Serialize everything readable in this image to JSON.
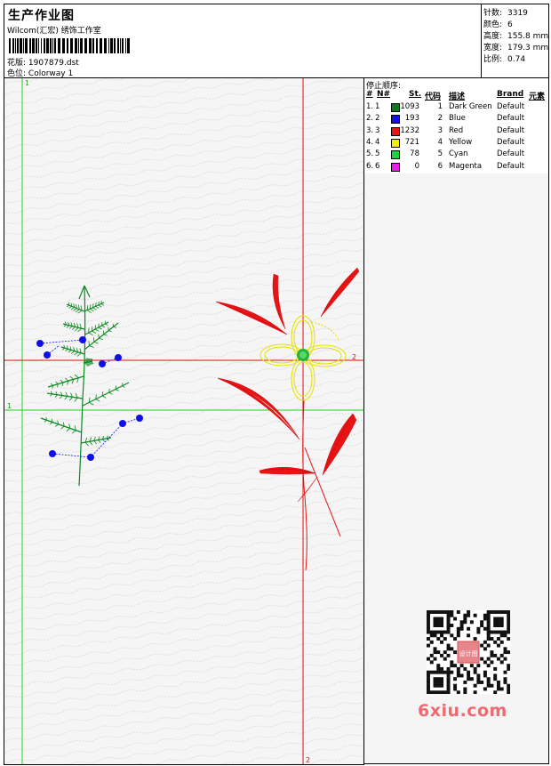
{
  "header": {
    "title": "生产作业图",
    "subtitle": "Wilcom(汇宏) 绣饰工作室",
    "design_label": "花版:",
    "design_value": "1907879.dst",
    "colorway_label": "色位:",
    "colorway_value": "Colorway 1"
  },
  "stats": [
    {
      "label": "针数:",
      "value": "3319"
    },
    {
      "label": "颜色:",
      "value": "6"
    },
    {
      "label": "高度:",
      "value": "155.8 mm"
    },
    {
      "label": "宽度:",
      "value": "179.3 mm"
    },
    {
      "label": "比例:",
      "value": "0.74"
    }
  ],
  "canvas": {
    "guide_label_top": "1",
    "guide_label_right": "2",
    "guide_label_left": "1",
    "guide_label_bottom": "2"
  },
  "color_table": {
    "title": "停止顺序:",
    "headers": {
      "num": "#",
      "n": "N#",
      "st": "St.",
      "code": "代码",
      "desc": "描述",
      "brand": "Brand",
      "elem": "元素"
    },
    "rows": [
      {
        "num": "1.",
        "n": "1",
        "color": "#0a7d1e",
        "st": "1093",
        "code": "1",
        "desc": "Dark Green",
        "brand": "Default"
      },
      {
        "num": "2.",
        "n": "2",
        "color": "#1010e6",
        "st": "193",
        "code": "2",
        "desc": "Blue",
        "brand": "Default"
      },
      {
        "num": "3.",
        "n": "3",
        "color": "#e61414",
        "st": "1232",
        "code": "3",
        "desc": "Red",
        "brand": "Default"
      },
      {
        "num": "4.",
        "n": "4",
        "color": "#f2ee10",
        "st": "721",
        "code": "4",
        "desc": "Yellow",
        "brand": "Default"
      },
      {
        "num": "5.",
        "n": "5",
        "color": "#22d23c",
        "st": "78",
        "code": "5",
        "desc": "Cyan",
        "brand": "Default"
      },
      {
        "num": "6.",
        "n": "6",
        "color": "#e61ee6",
        "st": "0",
        "code": "6",
        "desc": "Magenta",
        "brand": "Default"
      }
    ]
  },
  "watermark": {
    "text": "6xiu.com",
    "seal": "设计图"
  }
}
